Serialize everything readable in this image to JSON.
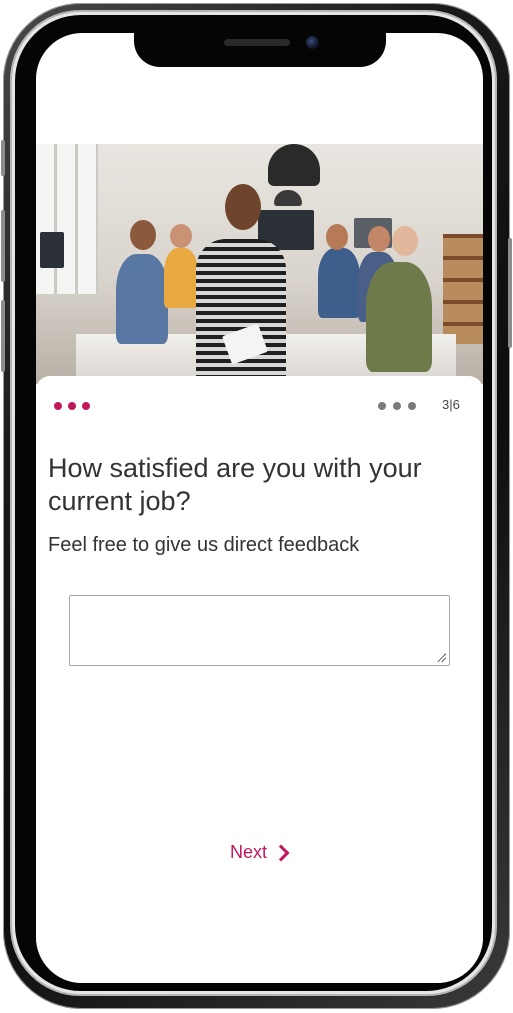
{
  "survey": {
    "progress_counter": "3|6",
    "question": "How satisfied are you with your current job?",
    "subtitle": "Feel free to give us direct feedback",
    "feedback_value": "",
    "next_label": "Next"
  },
  "colors": {
    "accent": "#c2185b",
    "progress_inactive": "#7a7a7a",
    "text": "#333333"
  },
  "icons": {
    "next": "chevron-right-icon",
    "resize": "resize-grip-icon"
  }
}
